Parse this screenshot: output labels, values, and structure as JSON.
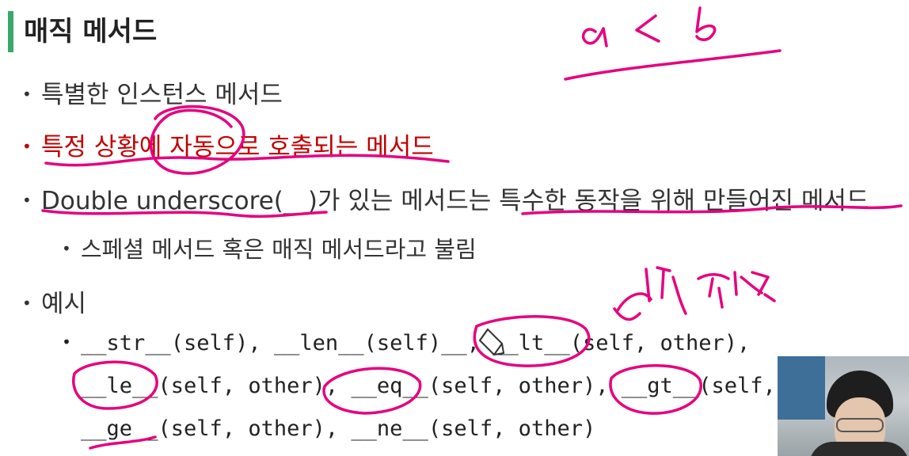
{
  "slide": {
    "title": "매직 메서드",
    "bullets": [
      "특별한 인스턴스 메서드",
      "특정 상황에 자동으로 호출되는 메서드",
      "Double underscore(__)가 있는 메서드는 특수한 동작을 위해 만들어진 메서드"
    ],
    "sub_bullet": "스페셜 메서드 혹은 매직 메서드라고 불림",
    "example_label": "예시",
    "example_lines": [
      "__str__(self), __len__(self)__, __lt__(self, other),",
      "__le__(self, other), __eq__(self, other), __gt__(self,",
      "__ge__(self, other), __ne__(self, other)"
    ],
    "bullet_glyph": "•"
  },
  "annotations": {
    "ink_color": "#e6007e",
    "comparison_note": "비교 연산자"
  },
  "colors": {
    "accent_bar": "#3aa86b",
    "highlight_text": "#c00000"
  },
  "icons": [
    "pencil-cursor-icon"
  ]
}
